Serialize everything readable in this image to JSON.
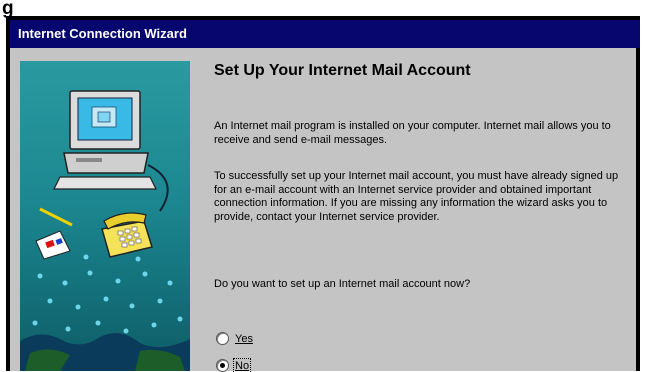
{
  "top_fragment": "g",
  "window": {
    "title": "Internet Connection Wizard"
  },
  "page": {
    "heading": "Set Up Your Internet Mail Account",
    "paragraph1": "An Internet mail program is installed on your computer. Internet mail allows you to receive and send e-mail messages.",
    "paragraph2": "To successfully set up your Internet mail account, you must have already signed up for an e-mail account with an Internet service provider and obtained important connection information. If you are missing any information the wizard asks you to provide, contact your Internet service provider.",
    "question": "Do you want to set up an Internet mail account now?"
  },
  "options": [
    {
      "label": "Yes",
      "selected": false
    },
    {
      "label": "No",
      "selected": true
    }
  ],
  "colors": {
    "title_bar": "#06066e",
    "dialog_face": "#c4c4c4",
    "art_teal": "#1c8790"
  },
  "icons": [
    "computer-illustration",
    "telephone-icon",
    "envelope-icon",
    "network-dots"
  ]
}
